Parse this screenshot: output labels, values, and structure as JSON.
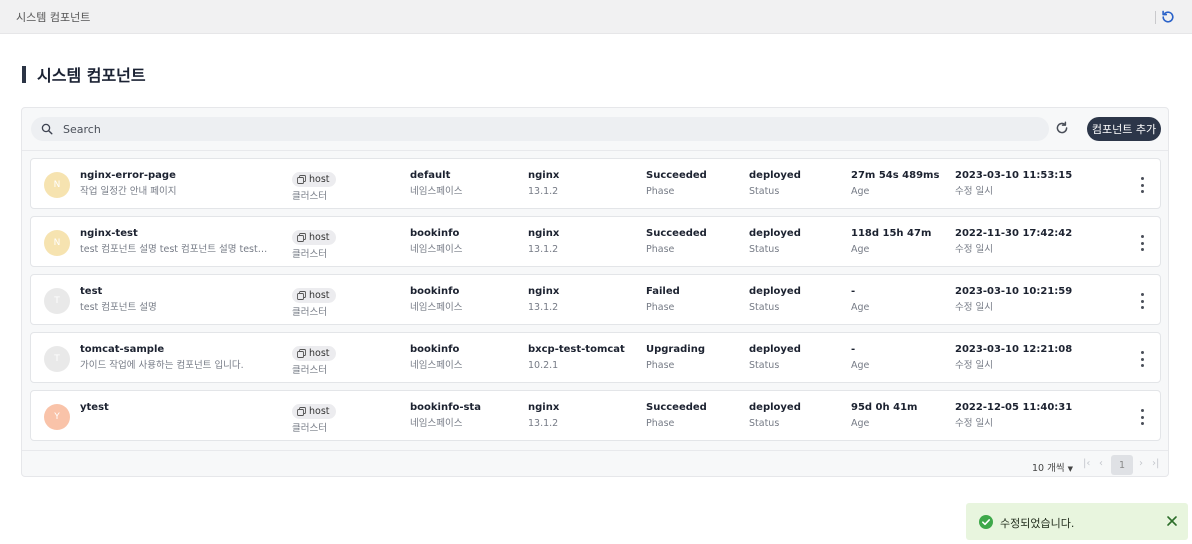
{
  "topbar": {
    "breadcrumb": "시스템 컴포넌트",
    "refresh_icon": "refresh-icon"
  },
  "page": {
    "title": "시스템 컴포넌트"
  },
  "toolbar": {
    "search_placeholder": "Search",
    "reload_icon": "reload-icon",
    "add_label": "컴포넌트 추가"
  },
  "rows": [
    {
      "initial": "N",
      "avatar_color": "#f6e3b0",
      "name": "nginx-error-page",
      "description": "작업 일정간 안내 페이지",
      "cluster": "host",
      "cluster_label": "클러스터",
      "namespace": "default",
      "namespace_label": "네임스페이스",
      "chart": "nginx",
      "version": "13.1.2",
      "phase": "Succeeded",
      "phase_label": "Phase",
      "status": "deployed",
      "status_label": "Status",
      "age": "27m 54s 489ms",
      "age_label": "Age",
      "updated": "2023-03-10 11:53:15",
      "updated_label": "수정 일시"
    },
    {
      "initial": "N",
      "avatar_color": "#f6e3b0",
      "name": "nginx-test",
      "description": "test 컴포넌트 설명 test 컴포넌트 설명 test 컴…",
      "cluster": "host",
      "cluster_label": "클러스터",
      "namespace": "bookinfo",
      "namespace_label": "네임스페이스",
      "chart": "nginx",
      "version": "13.1.2",
      "phase": "Succeeded",
      "phase_label": "Phase",
      "status": "deployed",
      "status_label": "Status",
      "age": "118d 15h 47m",
      "age_label": "Age",
      "updated": "2022-11-30 17:42:42",
      "updated_label": "수정 일시"
    },
    {
      "initial": "T",
      "avatar_color": "#e9e9e9",
      "name": "test",
      "description": "test 컴포넌트 설명",
      "cluster": "host",
      "cluster_label": "클러스터",
      "namespace": "bookinfo",
      "namespace_label": "네임스페이스",
      "chart": "nginx",
      "version": "13.1.2",
      "phase": "Failed",
      "phase_label": "Phase",
      "status": "deployed",
      "status_label": "Status",
      "age": "-",
      "age_label": "Age",
      "updated": "2023-03-10 10:21:59",
      "updated_label": "수정 일시"
    },
    {
      "initial": "T",
      "avatar_color": "#e9e9e9",
      "name": "tomcat-sample",
      "description": "가이드 작업에 사용하는 컴포넌트 입니다.",
      "cluster": "host",
      "cluster_label": "클러스터",
      "namespace": "bookinfo",
      "namespace_label": "네임스페이스",
      "chart": "bxcp-test-tomcat",
      "version": "10.2.1",
      "phase": "Upgrading",
      "phase_label": "Phase",
      "status": "deployed",
      "status_label": "Status",
      "age": "-",
      "age_label": "Age",
      "updated": "2023-03-10 12:21:08",
      "updated_label": "수정 일시"
    },
    {
      "initial": "Y",
      "avatar_color": "#f9c3a9",
      "name": "ytest",
      "description": "",
      "cluster": "host",
      "cluster_label": "클러스터",
      "namespace": "bookinfo-sta",
      "namespace_label": "네임스페이스",
      "chart": "nginx",
      "version": "13.1.2",
      "phase": "Succeeded",
      "phase_label": "Phase",
      "status": "deployed",
      "status_label": "Status",
      "age": "95d 0h 41m",
      "age_label": "Age",
      "updated": "2022-12-05 11:40:31",
      "updated_label": "수정 일시"
    }
  ],
  "pagination": {
    "per_page": "10 개씩",
    "first": "|‹",
    "prev": "‹",
    "current_page": "1",
    "next": "›",
    "last": "›|"
  },
  "toast": {
    "message": "수정되었습니다.",
    "success_icon": "check-circle-icon",
    "close_icon": "close-icon",
    "color": "#3ea84a"
  }
}
